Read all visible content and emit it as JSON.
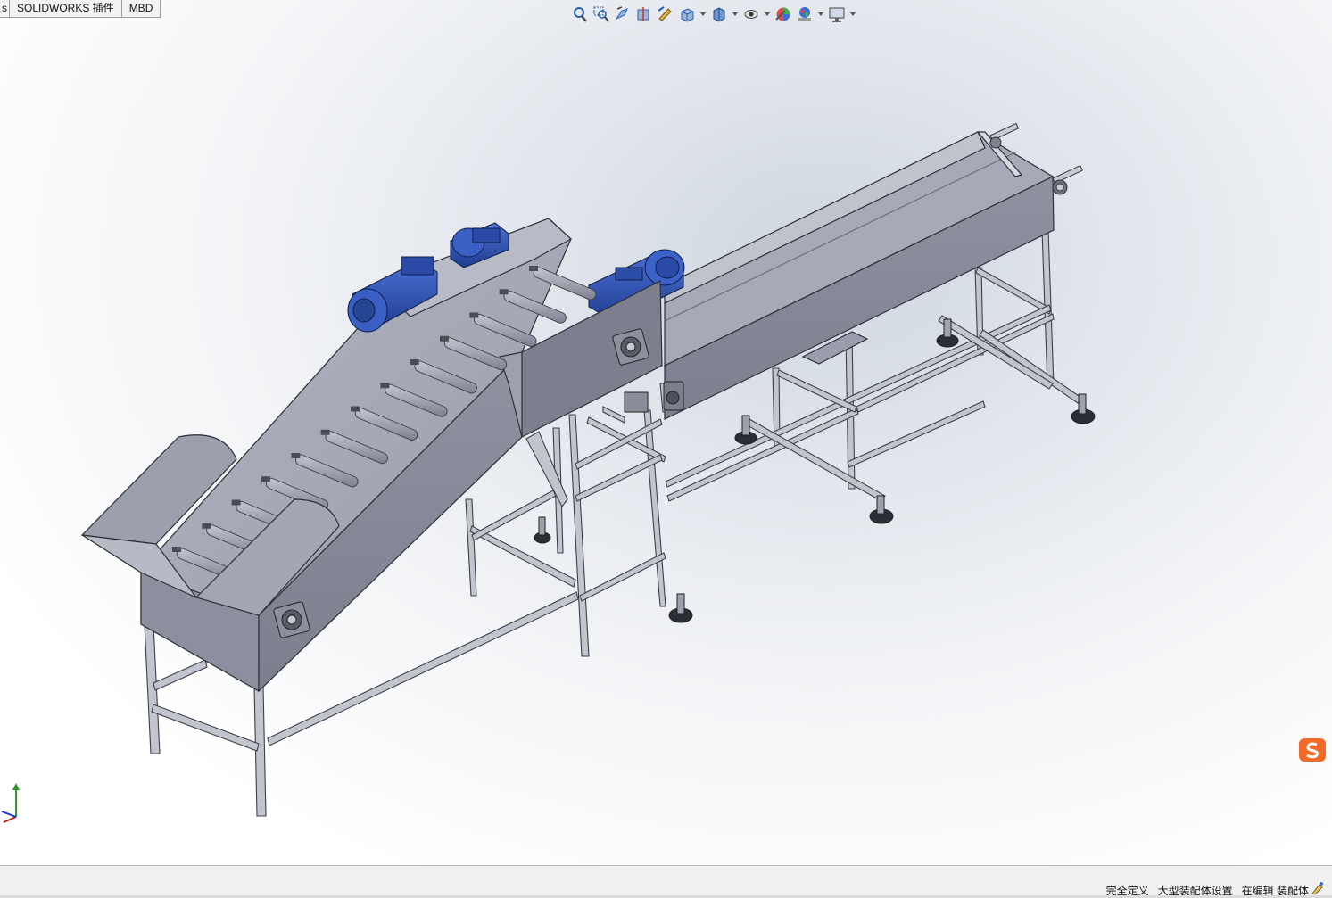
{
  "tabs": [
    {
      "label": "s",
      "partial": true
    },
    {
      "label": "SOLIDWORKS 插件"
    },
    {
      "label": "MBD"
    }
  ],
  "view_toolbar": [
    {
      "icon": "zoom-to-fit-icon",
      "dropdown": false
    },
    {
      "icon": "zoom-to-area-icon",
      "dropdown": false
    },
    {
      "icon": "previous-view-icon",
      "dropdown": false
    },
    {
      "icon": "section-view-icon",
      "dropdown": false
    },
    {
      "icon": "dynamic-annotation-icon",
      "dropdown": false
    },
    {
      "icon": "view-orientation-icon",
      "dropdown": true
    },
    {
      "icon": "display-style-icon",
      "dropdown": true
    },
    {
      "icon": "hide-show-items-icon",
      "dropdown": true
    },
    {
      "icon": "edit-appearance-icon",
      "dropdown": false
    },
    {
      "icon": "apply-scene-icon",
      "dropdown": true
    },
    {
      "icon": "view-settings-icon",
      "dropdown": true
    }
  ],
  "status": {
    "definition": "完全定义",
    "large_assembly": "大型装配体设置",
    "editing": "在编辑 装配体"
  },
  "colors": {
    "sheet_metal": "#8e919f",
    "sheet_metal_dark": "#6d7080",
    "sheet_metal_light": "#a9acb8",
    "motor_blue": "#2f55b8",
    "frame": "#b6b8c2",
    "roller": "#a3a6b3",
    "ime_orange": "#f06a2a"
  }
}
